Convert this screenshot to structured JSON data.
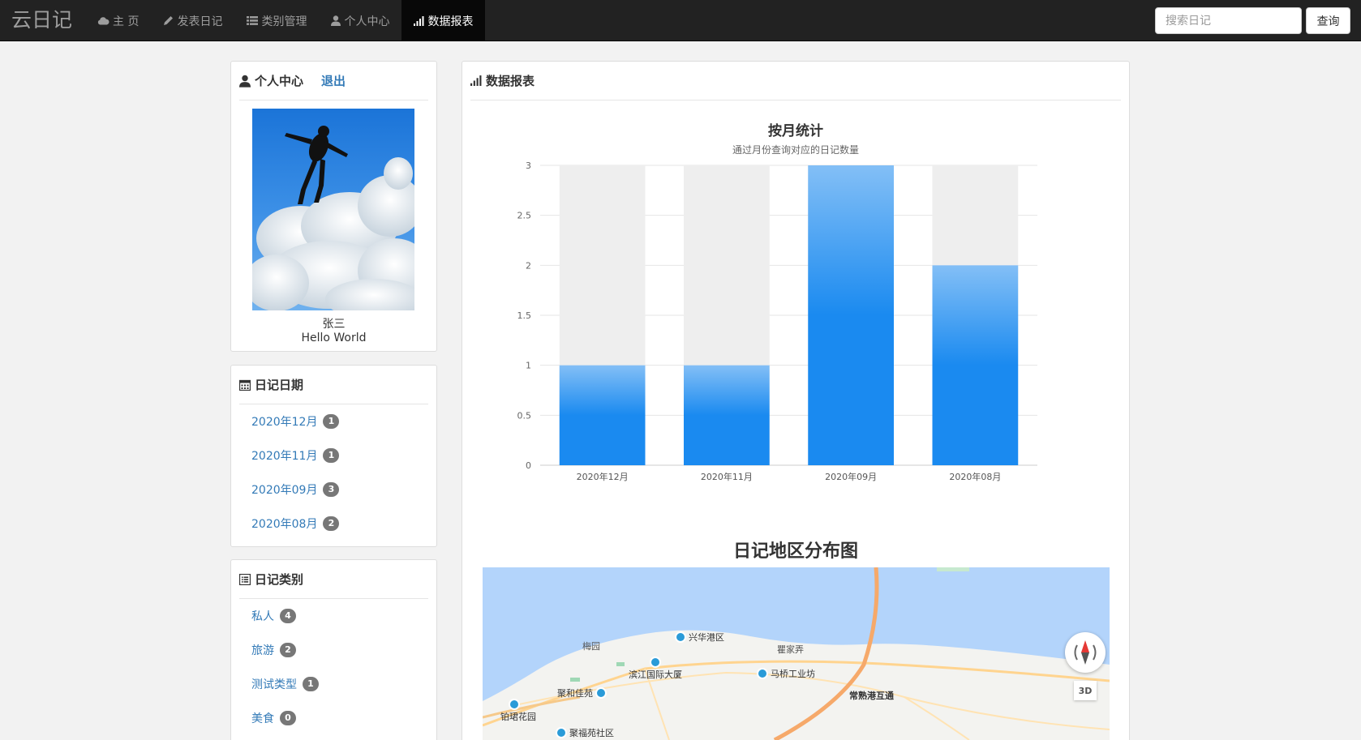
{
  "app": {
    "brand": "云日记"
  },
  "nav": {
    "items": [
      {
        "label": "主 页",
        "icon": "cloud-icon"
      },
      {
        "label": "发表日记",
        "icon": "pencil-icon"
      },
      {
        "label": "类别管理",
        "icon": "list-icon"
      },
      {
        "label": "个人中心",
        "icon": "user-icon"
      },
      {
        "label": "数据报表",
        "icon": "signal-icon",
        "active": true
      }
    ]
  },
  "search": {
    "placeholder": "搜索日记",
    "button": "查询"
  },
  "profile": {
    "title": "个人中心",
    "logout": "退出",
    "name": "张三",
    "signature": "Hello World"
  },
  "dates": {
    "title": "日记日期",
    "items": [
      {
        "label": "2020年12月",
        "count": "1"
      },
      {
        "label": "2020年11月",
        "count": "1"
      },
      {
        "label": "2020年09月",
        "count": "3"
      },
      {
        "label": "2020年08月",
        "count": "2"
      }
    ]
  },
  "categories": {
    "title": "日记类别",
    "items": [
      {
        "label": "私人",
        "count": "4"
      },
      {
        "label": "旅游",
        "count": "2"
      },
      {
        "label": "测试类型",
        "count": "1"
      },
      {
        "label": "美食",
        "count": "0"
      }
    ]
  },
  "report": {
    "title": "数据报表"
  },
  "chart_data": {
    "type": "bar",
    "title": "按月统计",
    "subtitle": "通过月份查询对应的日记数量",
    "categories": [
      "2020年12月",
      "2020年11月",
      "2020年09月",
      "2020年08月"
    ],
    "values": [
      1,
      1,
      3,
      2
    ],
    "ylim": [
      0,
      3
    ],
    "yticks": [
      0,
      0.5,
      1,
      1.5,
      2,
      2.5,
      3
    ],
    "grid": true,
    "bar_color": "#1a8af0",
    "bar_top_color": "#83bff6",
    "background_bar_color": "#eeeeee"
  },
  "map": {
    "title": "日记地区分布图",
    "labels": [
      {
        "text": "兴华港区",
        "poi": true
      },
      {
        "text": "梅园",
        "poi": false
      },
      {
        "text": "瞿家弄",
        "poi": false
      },
      {
        "text": "滨江国际大厦",
        "poi": true
      },
      {
        "text": "马桥工业坊",
        "poi": true
      },
      {
        "text": "聚和佳苑",
        "poi": true
      },
      {
        "text": "常熟港互通",
        "poi": false
      },
      {
        "text": "铂珺花园",
        "poi": true
      },
      {
        "text": "聚福苑社区",
        "poi": true
      }
    ],
    "btn_3d": "3D",
    "water_color": "#b3d4fb",
    "land_color": "#f3f3f0"
  },
  "colors": {
    "link": "#337ab7",
    "nav_bg": "#222222",
    "badge": "#777777"
  }
}
